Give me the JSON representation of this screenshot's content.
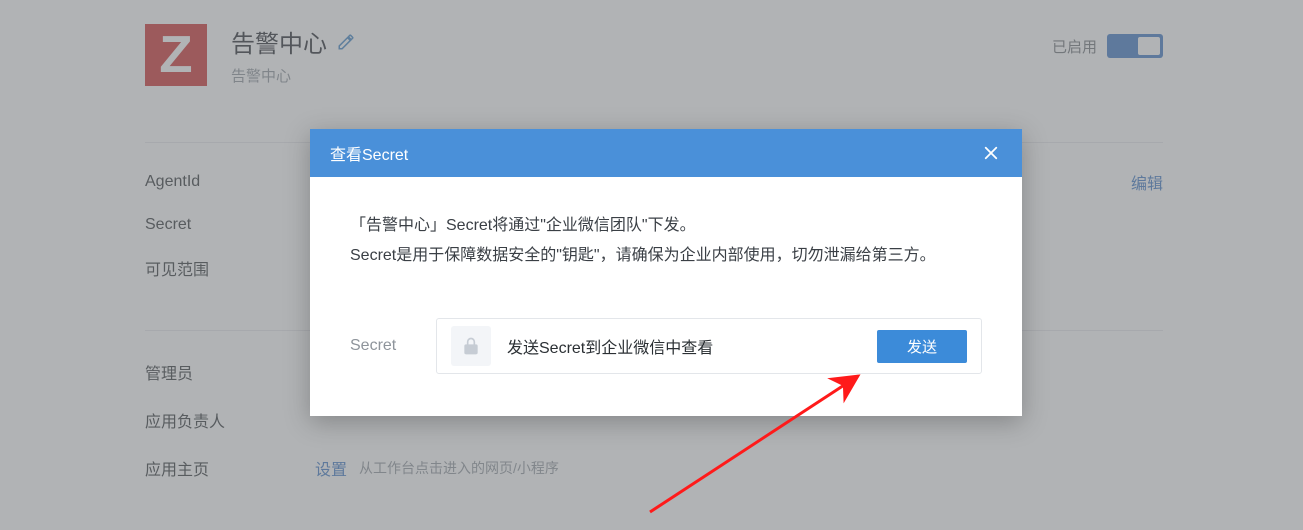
{
  "header": {
    "logo_letter": "Z",
    "title": "告警中心",
    "subtitle": "告警中心",
    "enabled_label": "已启用"
  },
  "details": {
    "agent_id_label": "AgentId",
    "secret_label": "Secret",
    "visible_scope_label": "可见范围",
    "edit_link": "编辑"
  },
  "settings": {
    "admin_label": "管理员",
    "app_owner_label": "应用负责人",
    "app_home_label": "应用主页",
    "app_home_link": "设置",
    "app_home_hint": "从工作台点击进入的网页/小程序"
  },
  "modal": {
    "title": "查看Secret",
    "line1": "「告警中心」Secret将通过\"企业微信团队\"下发。",
    "line2": "Secret是用于保障数据安全的\"钥匙\"，请确保为企业内部使用，切勿泄漏给第三方。",
    "secret_label": "Secret",
    "secret_message": "发送Secret到企业微信中查看",
    "send_button": "发送"
  }
}
